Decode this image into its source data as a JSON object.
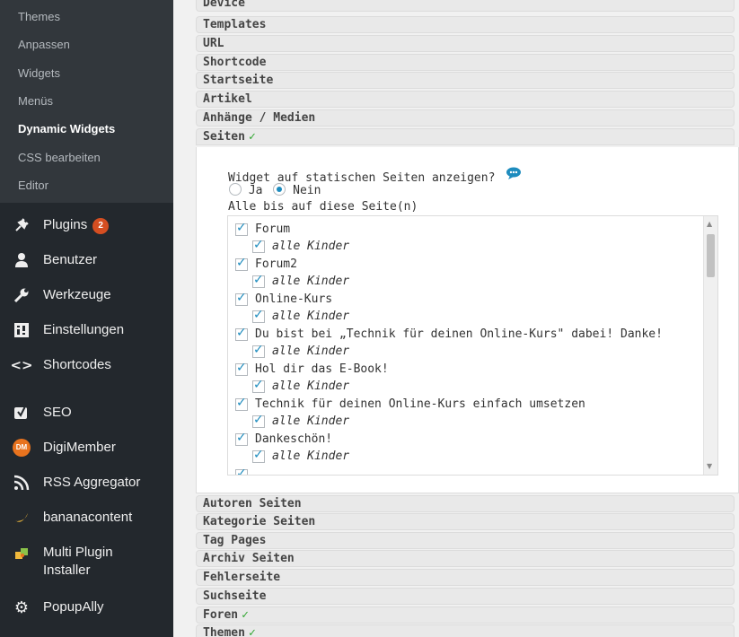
{
  "sidebar": {
    "submenu": [
      {
        "label": "Themes",
        "current": false
      },
      {
        "label": "Anpassen",
        "current": false
      },
      {
        "label": "Widgets",
        "current": false
      },
      {
        "label": "Menüs",
        "current": false
      },
      {
        "label": "Dynamic Widgets",
        "current": true
      },
      {
        "label": "CSS bearbeiten",
        "current": false
      },
      {
        "label": "Editor",
        "current": false
      }
    ],
    "menu": [
      {
        "label": "Plugins",
        "icon": "plugin-icon",
        "badge": "2"
      },
      {
        "label": "Benutzer",
        "icon": "user-icon"
      },
      {
        "label": "Werkzeuge",
        "icon": "wrench-icon"
      },
      {
        "label": "Einstellungen",
        "icon": "settings-icon"
      },
      {
        "label": "Shortcodes",
        "icon": "code-icon"
      },
      {
        "label": "SEO",
        "icon": "seo-icon"
      },
      {
        "label": "DigiMember",
        "icon": "digimember-icon",
        "icon_text": "DM"
      },
      {
        "label": "RSS Aggregator",
        "icon": "rss-icon"
      },
      {
        "label": "bananacontent",
        "icon": "banana-icon"
      },
      {
        "label": "Multi Plugin Installer",
        "label_line1": "Multi Plugin",
        "label_line2": "Installer",
        "icon": "puzzle-icon"
      },
      {
        "label": "PopupAlly",
        "icon": "gear-icon"
      }
    ]
  },
  "sections_top": [
    {
      "label": "Device"
    },
    {
      "label": "Templates"
    },
    {
      "label": "URL"
    },
    {
      "label": "Shortcode"
    },
    {
      "label": "Startseite"
    },
    {
      "label": "Artikel"
    },
    {
      "label": "Anhänge / Medien"
    },
    {
      "label": "Seiten",
      "checked": true
    }
  ],
  "seiten_panel": {
    "question": "Widget auf statischen Seiten anzeigen?",
    "option_yes": "Ja",
    "option_no": "Nein",
    "selected": "Nein",
    "except_label": "Alle bis auf diese Seite(n)",
    "pages": [
      {
        "label": "Forum",
        "children_label": "alle Kinder"
      },
      {
        "label": "Forum2",
        "children_label": "alle Kinder"
      },
      {
        "label": "Online-Kurs",
        "children_label": "alle Kinder"
      },
      {
        "label": "Du bist bei „Technik für deinen Online-Kurs\" dabei! Danke!",
        "children_label": "alle Kinder"
      },
      {
        "label": "Hol dir das E-Book!",
        "children_label": "alle Kinder"
      },
      {
        "label": "Technik für deinen Online-Kurs einfach umsetzen",
        "children_label": "alle Kinder"
      },
      {
        "label": "Dankeschön!",
        "children_label": "alle Kinder"
      }
    ]
  },
  "sections_bottom": [
    {
      "label": "Autoren Seiten"
    },
    {
      "label": "Kategorie Seiten"
    },
    {
      "label": "Tag Pages"
    },
    {
      "label": "Archiv Seiten"
    },
    {
      "label": "Fehlerseite"
    },
    {
      "label": "Suchseite"
    },
    {
      "label": "Foren",
      "checked": true
    },
    {
      "label": "Themen",
      "checked": true
    }
  ],
  "colors": {
    "sidebar_bg": "#23282d",
    "submenu_bg": "#32373c",
    "checkbox_accent": "#1e8cbe",
    "check_green": "#2fa52f",
    "badge": "#d54e21"
  }
}
